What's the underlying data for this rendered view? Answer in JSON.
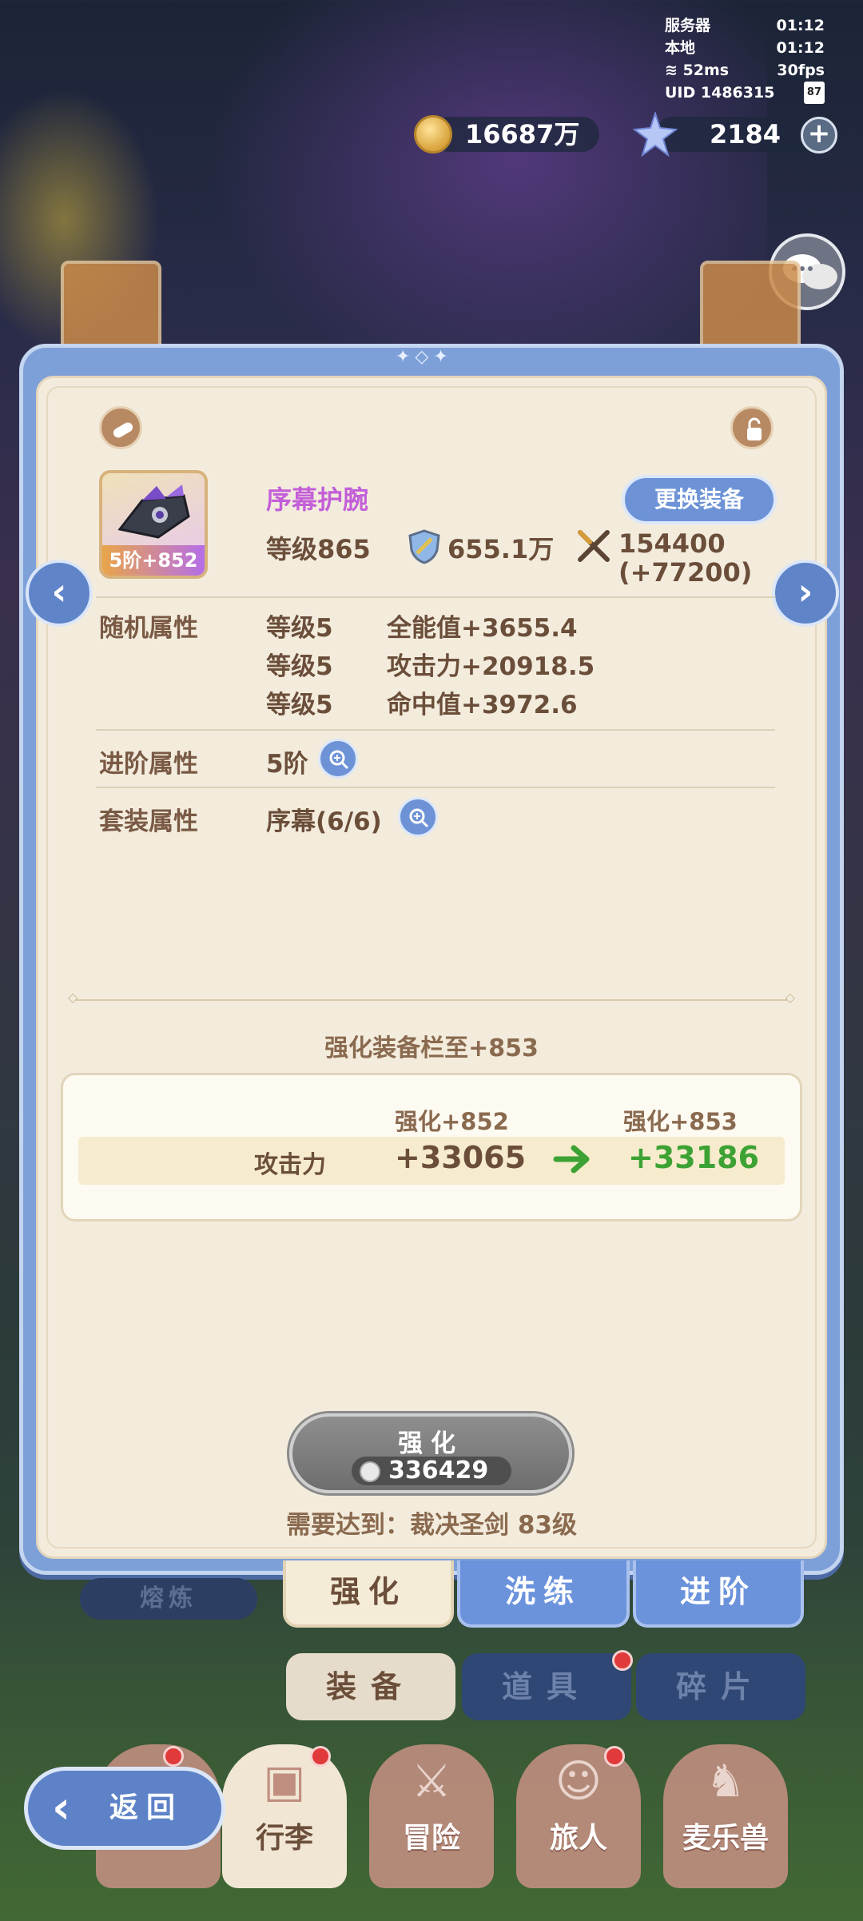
{
  "status": {
    "server_label": "服务器",
    "server_time": "01:12",
    "local_label": "本地",
    "local_time": "01:12",
    "ping": "52ms",
    "fps": "30fps",
    "uid": "UID  1486315",
    "battery": "87"
  },
  "currency": {
    "gold": "16687万",
    "stars": "2184"
  },
  "item": {
    "name": "序幕护腕",
    "badge": "5阶+852",
    "level": "等级865",
    "power": "655.1万",
    "atk_line1": "154400",
    "atk_line2": "(+77200)",
    "change_button": "更换装备"
  },
  "random_attrs": {
    "label": "随机属性",
    "rows": [
      {
        "level": "等级5",
        "value": "全能值+3655.4"
      },
      {
        "level": "等级5",
        "value": "攻击力+20918.5"
      },
      {
        "level": "等级5",
        "value": "命中值+3972.6"
      }
    ]
  },
  "advance_attrs": {
    "label": "进阶属性",
    "value": "5阶"
  },
  "set_attrs": {
    "label": "套装属性",
    "value": "序幕(6/6)"
  },
  "enhance": {
    "title": "强化装备栏至+853",
    "col_old": "强化+852",
    "col_new": "强化+853",
    "stat_label": "攻击力",
    "stat_old": "+33065",
    "stat_new": "+33186",
    "button_label": "强化",
    "cost": "336429",
    "requirement": "需要达到：裁决圣剑 83级"
  },
  "tabs": {
    "melt": "熔炼",
    "enhance": "强化",
    "wash": "洗练",
    "advance": "进阶"
  },
  "subtabs": {
    "equipment": "装备",
    "items": "道具",
    "fragments": "碎片"
  },
  "bottom_nav": {
    "bag": "行李",
    "adventure": "冒险",
    "traveler": "旅人",
    "pet": "麦乐兽"
  },
  "back": "返回",
  "colors": {
    "accent_blue": "#6d93d6",
    "item_name": "#c35fd8",
    "increase_green": "#3da234",
    "panel_bg": "#f3ecdd"
  }
}
